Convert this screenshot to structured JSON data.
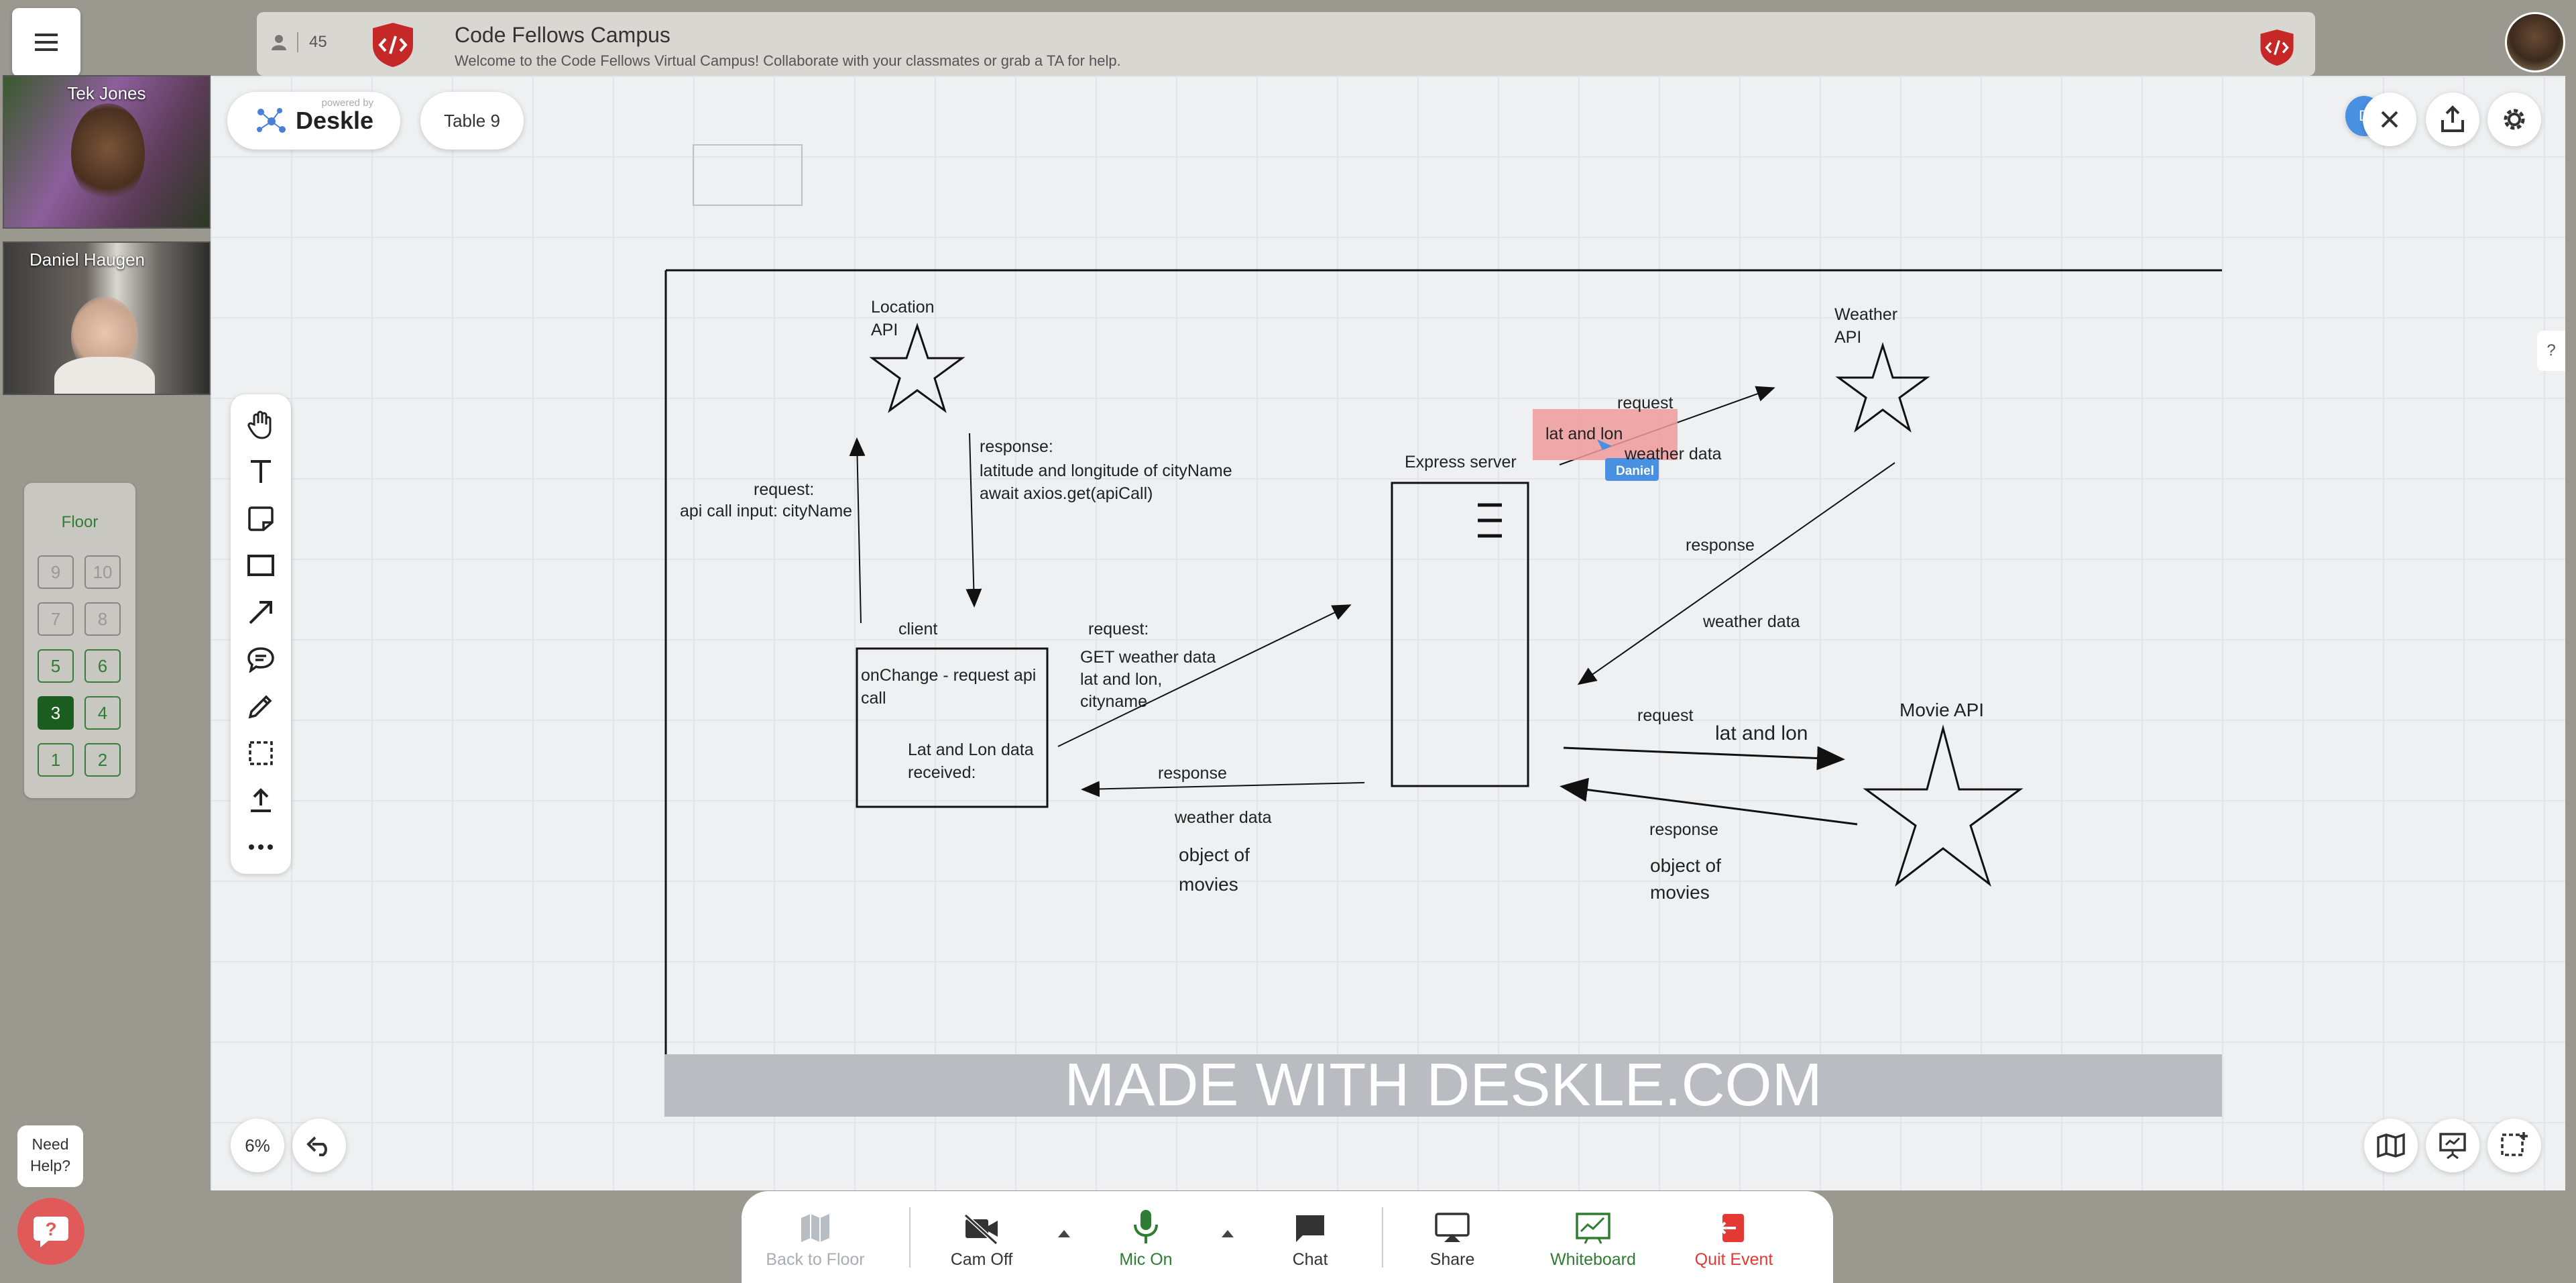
{
  "app": {
    "participant_count": "45",
    "campus_title": "Code Fellows Campus",
    "campus_subtitle": "Welcome to the Code Fellows Virtual Campus! Collaborate with your classmates or grab a TA for help."
  },
  "participants": [
    {
      "name": "Tek Jones"
    },
    {
      "name": "Daniel Haugen"
    }
  ],
  "floor": {
    "title": "Floor",
    "rooms": [
      {
        "label": "9",
        "state": "disabled"
      },
      {
        "label": "10",
        "state": "disabled"
      },
      {
        "label": "7",
        "state": "disabled"
      },
      {
        "label": "8",
        "state": "disabled"
      },
      {
        "label": "5",
        "state": "enabled"
      },
      {
        "label": "6",
        "state": "enabled"
      },
      {
        "label": "3",
        "state": "current"
      },
      {
        "label": "4",
        "state": "enabled"
      },
      {
        "label": "1",
        "state": "enabled"
      },
      {
        "label": "2",
        "state": "enabled"
      }
    ]
  },
  "help": {
    "bubble": [
      "Need",
      "Help?"
    ]
  },
  "whiteboard": {
    "brand_powered": "powered by",
    "brand_name": "Deskle",
    "table_label": "Table 9",
    "avatar_initial": "D",
    "zoom": "6%",
    "watermark": "MADE WITH DESKLE.COM",
    "help_marker": "?",
    "cursor_user": "Daniel",
    "tools": [
      "hand-icon",
      "text-icon",
      "sticky-note-icon",
      "rectangle-icon",
      "arrow-icon",
      "comment-icon",
      "pencil-icon",
      "select-icon",
      "upload-icon",
      "more-icon"
    ],
    "diagram": {
      "location_api": [
        "Location",
        "API"
      ],
      "weather_api": [
        "Weather",
        "API"
      ],
      "movie_api": "Movie API",
      "request_city_1": "request:",
      "request_city_2": "api call input: cityName",
      "response_loc_1": "response:",
      "response_loc_2": "latitude and longitude of cityName",
      "response_loc_3": "await axios.get(apiCall)",
      "client": "client",
      "client_box_1": "onChange - request api",
      "client_box_2": "call",
      "client_box_3": "Lat and Lon data",
      "client_box_4": "received:",
      "request_weather_1": "request:",
      "request_weather_2": "GET weather data",
      "request_weather_3": "lat and lon,",
      "request_weather_4": "cityname",
      "response_mid": "response",
      "weather_data_mid": "weather data",
      "object_movies_mid_1": "object of",
      "object_movies_mid_2": "movies",
      "express_server": "Express server",
      "sticky_lat_lon": "lat and lon",
      "request_top": "request",
      "weather_data_top": "weather data",
      "response_weather": "response",
      "weather_data_right": "weather data",
      "request_movie": "request",
      "lat_lon_movie": "lat and lon",
      "response_movie": "response",
      "object_movies_right_1": "object of",
      "object_movies_right_2": "movies"
    }
  },
  "bottom_bar": {
    "back_to_floor": "Back to Floor",
    "cam": "Cam Off",
    "mic": "Mic On",
    "chat": "Chat",
    "share": "Share",
    "whiteboard": "Whiteboard",
    "quit": "Quit Event"
  },
  "colors": {
    "green": "#2e7d32",
    "red": "#e53935",
    "disabled": "#a8aeb4",
    "sticky": "#ef9a9a",
    "cursor_blue": "#4a90e2"
  }
}
